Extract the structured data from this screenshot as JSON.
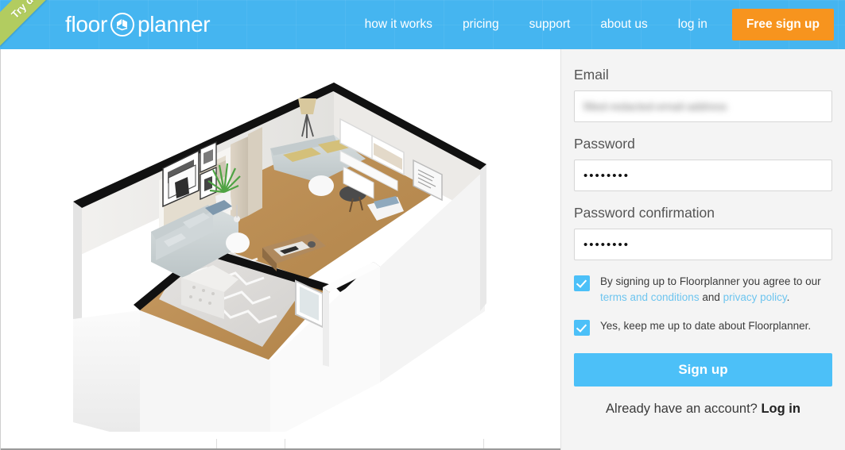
{
  "header": {
    "ribbon_label": "Try demo",
    "logo": {
      "word_left": "floor",
      "word_right": "planner",
      "mark_icon": "house-book-circle-icon"
    },
    "nav": [
      {
        "label": "how it works",
        "name": "nav-how-it-works"
      },
      {
        "label": "pricing",
        "name": "nav-pricing"
      },
      {
        "label": "support",
        "name": "nav-support"
      },
      {
        "label": "about us",
        "name": "nav-about-us"
      },
      {
        "label": "log in",
        "name": "nav-log-in"
      }
    ],
    "cta_label": "Free sign up"
  },
  "colors": {
    "header_blue": "#45b5f0",
    "cta_orange": "#f7941e",
    "button_blue": "#4cc0f8",
    "panel_gray": "#f4f4f4",
    "link_blue": "#6ec5ef",
    "ribbon_green": "#b2cc60"
  },
  "form": {
    "email": {
      "label": "Email",
      "value": "filled-redacted-email-address",
      "placeholder": ""
    },
    "password": {
      "label": "Password",
      "value": "••••••••",
      "placeholder": ""
    },
    "password_confirmation": {
      "label": "Password confirmation",
      "value": "••••••••",
      "placeholder": ""
    },
    "terms_checkbox": {
      "checked": true,
      "text_before": "By signing up to Floorplanner you agree to our",
      "link_terms": "terms and conditions",
      "text_and": "and",
      "link_privacy": "privacy policy",
      "text_after": "."
    },
    "newsletter_checkbox": {
      "checked": true,
      "text": "Yes, keep me up to date about Floorplanner."
    },
    "submit_label": "Sign up",
    "already_text": "Already have an account?",
    "already_link": "Log in"
  },
  "visual": {
    "alt": "3d-floorplan-render-living-room"
  }
}
